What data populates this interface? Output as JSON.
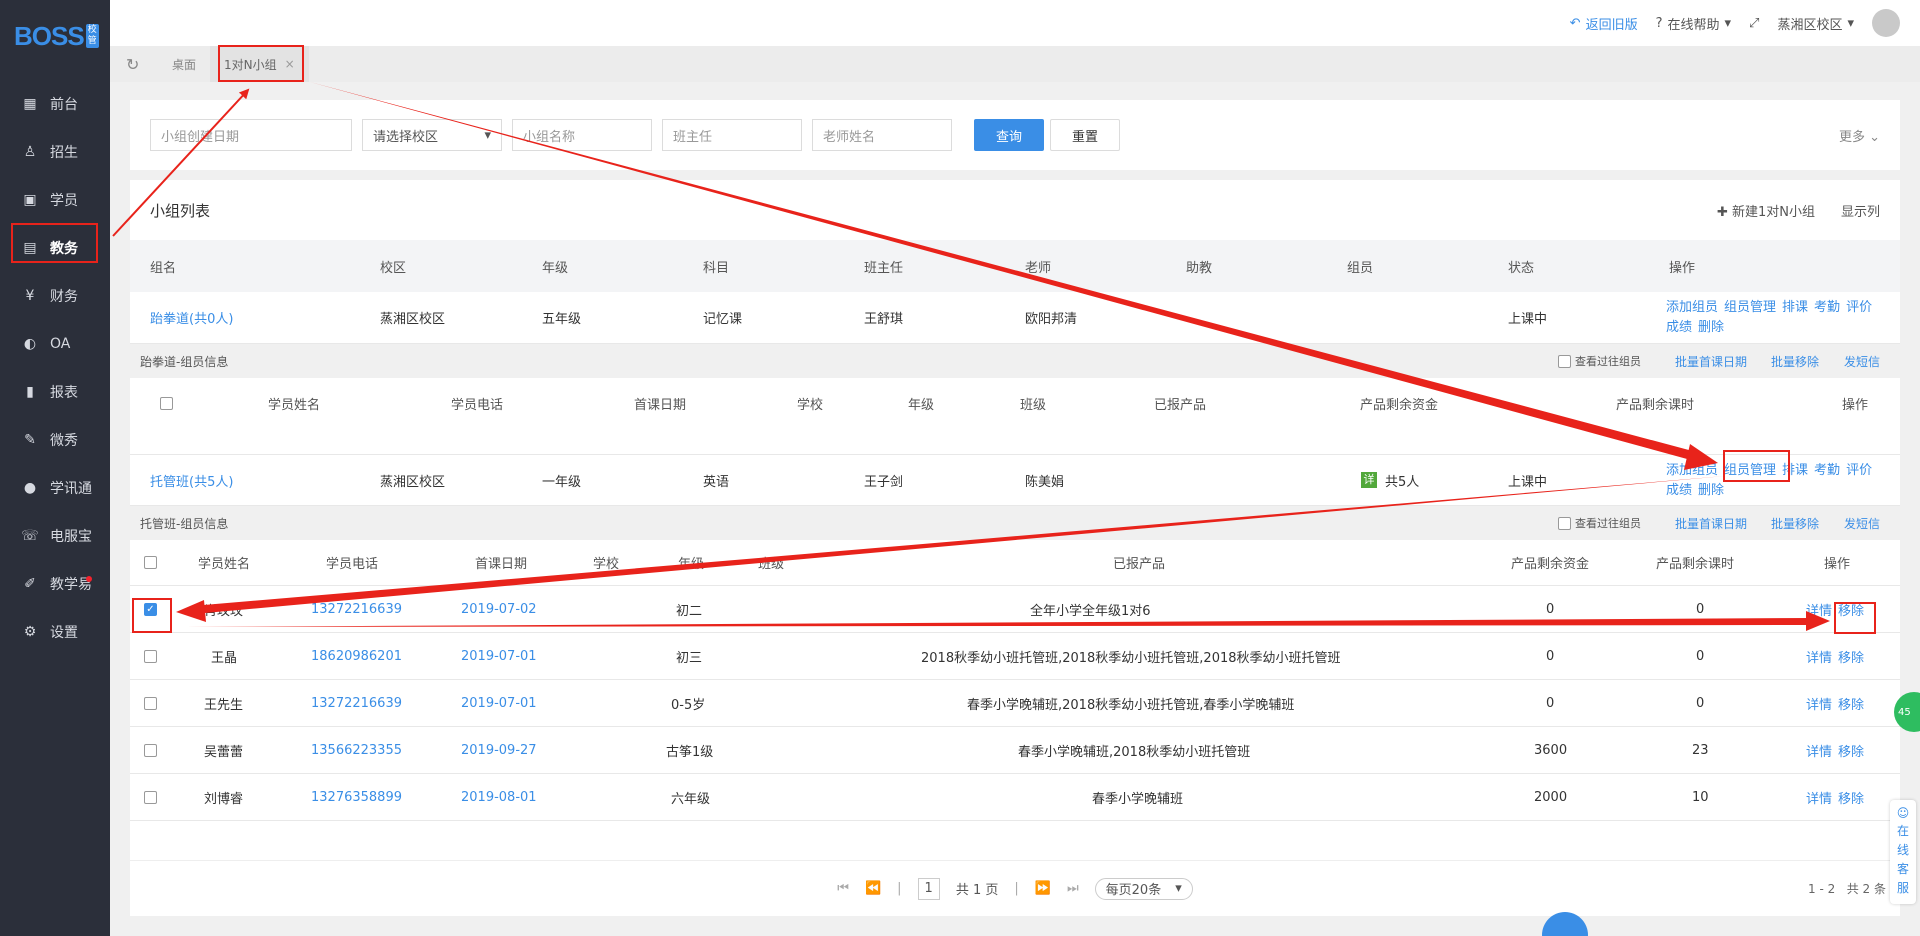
{
  "brand": {
    "logo": "BOSS",
    "badge": "校管"
  },
  "sidebar": {
    "items": [
      {
        "label": "前台",
        "icon": "calendar-icon"
      },
      {
        "label": "招生",
        "icon": "user-plus-icon"
      },
      {
        "label": "学员",
        "icon": "student-icon"
      },
      {
        "label": "教务",
        "icon": "academic-icon",
        "active": true
      },
      {
        "label": "财务",
        "icon": "finance-icon"
      },
      {
        "label": "OA",
        "icon": "toggle-icon"
      },
      {
        "label": "报表",
        "icon": "bar-chart-icon"
      },
      {
        "label": "微秀",
        "icon": "micro-show-icon"
      },
      {
        "label": "学讯通",
        "icon": "location-icon"
      },
      {
        "label": "电服宝",
        "icon": "phone-service-icon"
      },
      {
        "label": "教学易",
        "icon": "teaching-icon",
        "dot": true
      },
      {
        "label": "设置",
        "icon": "gear-icon"
      }
    ]
  },
  "topbar": {
    "back": "返回旧版",
    "help": "在线帮助",
    "campus": "蒸湘区校区"
  },
  "tabs": [
    {
      "label": "桌面"
    },
    {
      "label": "1对N小组"
    }
  ],
  "filter": {
    "date_placeholder": "小组创建日期",
    "campus_select": "请选择校区",
    "group_placeholder": "小组名称",
    "headteacher_placeholder": "班主任",
    "teacher_placeholder": "老师姓名",
    "query": "查询",
    "reset": "重置",
    "more": "更多"
  },
  "panel": {
    "title": "小组列表",
    "new_group": "新建1对N小组",
    "show_cols": "显示列"
  },
  "group_headers": [
    "组名",
    "校区",
    "年级",
    "科目",
    "班主任",
    "老师",
    "助教",
    "组员",
    "状态",
    "操作"
  ],
  "groups": [
    {
      "name": "跆拳道(共0人)",
      "campus": "蒸湘区校区",
      "grade": "五年级",
      "subject": "记忆课",
      "headteacher": "王舒琪",
      "teacher": "欧阳邦清",
      "assistant": "",
      "members": "",
      "status": "上课中"
    },
    {
      "name": "托管班(共5人)",
      "campus": "蒸湘区校区",
      "grade": "一年级",
      "subject": "英语",
      "headteacher": "王子剑",
      "teacher": "陈美娟",
      "assistant": "",
      "members_badge": "详",
      "members": "共5人",
      "status": "上课中"
    }
  ],
  "ops": {
    "add": "添加组员",
    "manage": "组员管理",
    "schedule": "排课",
    "attendance": "考勤",
    "evaluate": "评价",
    "score": "成绩",
    "delete": "删除"
  },
  "sub_section": {
    "title1": "跆拳道-组员信息",
    "title2": "托管班-组员信息",
    "show_past": "查看过往组员",
    "batch_date": "批量首课日期",
    "batch_remove": "批量移除",
    "sms": "发短信"
  },
  "member_headers_1": [
    "学员姓名",
    "学员电话",
    "首课日期",
    "学校",
    "年级",
    "班级",
    "已报产品",
    "产品剩余资金",
    "产品剩余课时",
    "操作"
  ],
  "member_headers_2": [
    "学员姓名",
    "学员电话",
    "首课日期",
    "学校",
    "年级",
    "班级",
    "已报产品",
    "产品剩余资金",
    "产品剩余课时",
    "操作"
  ],
  "members": [
    {
      "name": "肖玫玫",
      "phone": "13272216639",
      "date": "2019-07-02",
      "grade": "初二",
      "product": "全年小学全年级1对6",
      "fund": "0",
      "hours": "0",
      "checked": true
    },
    {
      "name": "王晶",
      "phone": "18620986201",
      "date": "2019-07-01",
      "grade": "初三",
      "product": "2018秋季幼小班托管班,2018秋季幼小班托管班,2018秋季幼小班托管班",
      "fund": "0",
      "hours": "0"
    },
    {
      "name": "王先生",
      "phone": "13272216639",
      "date": "2019-07-01",
      "grade": "0-5岁",
      "product": "春季小学晚辅班,2018秋季幼小班托管班,春季小学晚辅班",
      "fund": "0",
      "hours": "0"
    },
    {
      "name": "吴蕾蕾",
      "phone": "13566223355",
      "date": "2019-09-27",
      "grade": "古筝1级",
      "product": "春季小学晚辅班,2018秋季幼小班托管班",
      "fund": "3600",
      "hours": "23"
    },
    {
      "name": "刘博睿",
      "phone": "13276358899",
      "date": "2019-08-01",
      "grade": "六年级",
      "product": "春季小学晚辅班",
      "fund": "2000",
      "hours": "10"
    }
  ],
  "member_ops": {
    "detail": "详情",
    "remove": "移除"
  },
  "pagination": {
    "page": "1",
    "total_pages": "共 1 页",
    "per_page": "每页20条",
    "range": "1 - 2",
    "total": "共 2 条"
  },
  "float": {
    "service": [
      "在",
      "线",
      "客",
      "服"
    ],
    "green": "45"
  },
  "colors": {
    "accent": "#3a8ee6",
    "annotation": "#e8231b",
    "sidebar": "#2b2f3a"
  }
}
